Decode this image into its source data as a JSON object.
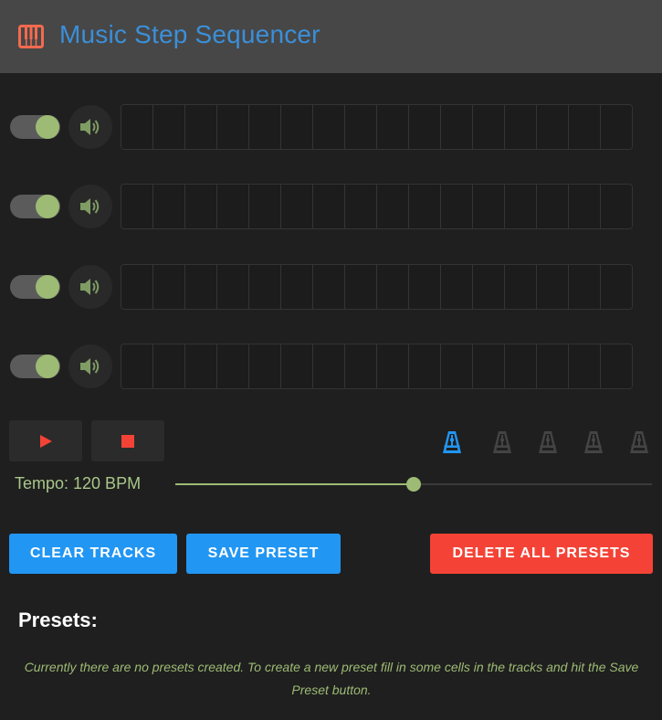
{
  "header": {
    "title": "Music Step Sequencer",
    "logo_icon": "piano-icon",
    "accent_color": "#3b8fd9"
  },
  "tracks": [
    {
      "enabled": true,
      "muted": false,
      "steps": [
        0,
        0,
        0,
        0,
        0,
        0,
        0,
        0,
        0,
        0,
        0,
        0,
        0,
        0,
        0,
        0
      ]
    },
    {
      "enabled": true,
      "muted": false,
      "steps": [
        0,
        0,
        0,
        0,
        0,
        0,
        0,
        0,
        0,
        0,
        0,
        0,
        0,
        0,
        0,
        0
      ]
    },
    {
      "enabled": true,
      "muted": false,
      "steps": [
        0,
        0,
        0,
        0,
        0,
        0,
        0,
        0,
        0,
        0,
        0,
        0,
        0,
        0,
        0,
        0
      ]
    },
    {
      "enabled": true,
      "muted": false,
      "steps": [
        0,
        0,
        0,
        0,
        0,
        0,
        0,
        0,
        0,
        0,
        0,
        0,
        0,
        0,
        0,
        0
      ]
    }
  ],
  "transport": {
    "play_icon": "play-icon",
    "stop_icon": "stop-icon"
  },
  "metronome": {
    "icon": "metronome-icon",
    "count": 5,
    "active_index": 0,
    "active_color": "#2196f3",
    "inactive_color": "#444444"
  },
  "tempo": {
    "label": "Tempo: 120 BPM",
    "bpm": 120,
    "fraction": 0.5
  },
  "buttons": {
    "clear": "CLEAR TRACKS",
    "save": "SAVE PRESET",
    "delete_all": "DELETE ALL PRESETS"
  },
  "presets": {
    "title": "Presets:",
    "empty_message": "Currently there are no presets created. To create a new preset fill in some cells in the tracks and hit the Save Preset button."
  }
}
